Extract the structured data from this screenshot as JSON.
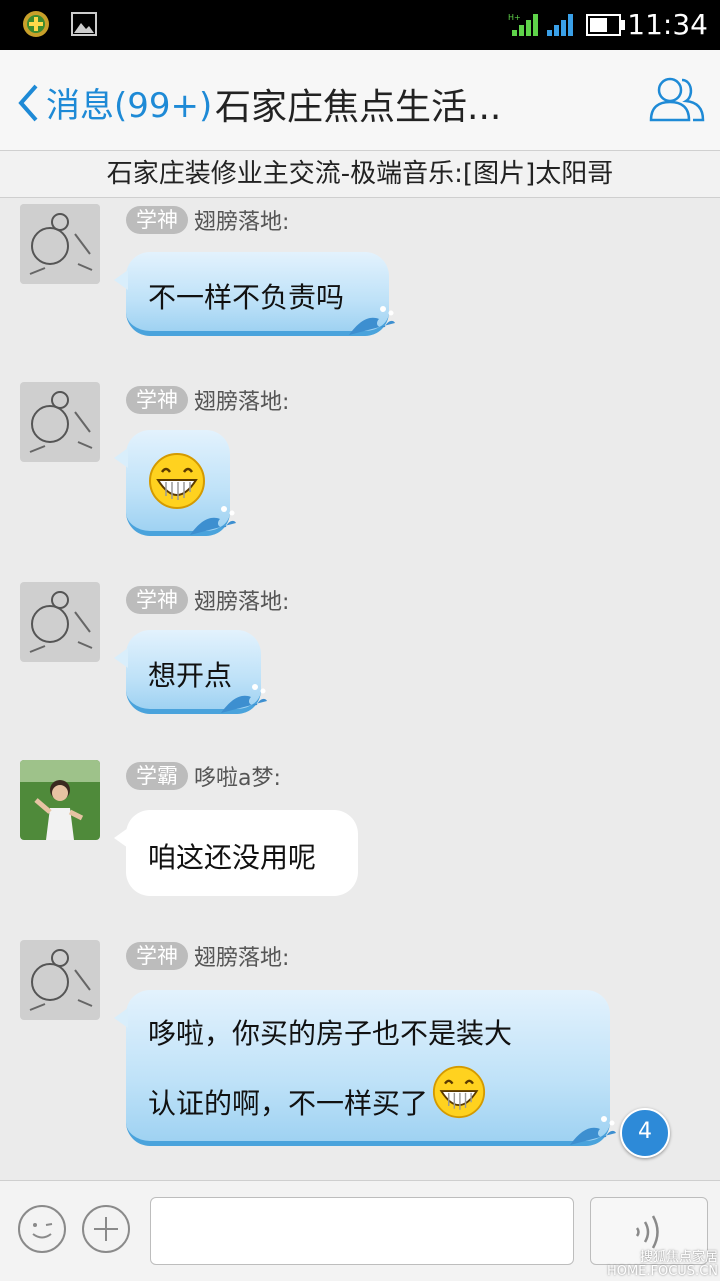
{
  "status": {
    "time": "11:34",
    "network": "H+"
  },
  "nav": {
    "back_label": "消息(99+)",
    "title": "石家庄焦点生活...",
    "contacts_icon": "group-contacts-icon"
  },
  "notice": "石家庄装修业主交流-极端音乐:[图片]太阳哥",
  "messages": [
    {
      "tag": "学神",
      "name": "翅膀落地:",
      "text": "不一样不负责吗",
      "style": "blue"
    },
    {
      "tag": "学神",
      "name": "翅膀落地:",
      "emoji": "grin-emoji",
      "style": "blue"
    },
    {
      "tag": "学神",
      "name": "翅膀落地:",
      "text": "想开点",
      "style": "blue"
    },
    {
      "tag": "学霸",
      "name": "哆啦a梦:",
      "text": "咱这还没用呢",
      "style": "white"
    },
    {
      "tag": "学神",
      "name": "翅膀落地:",
      "line1": "哆啦，你买的房子也不是装大",
      "line2": "认证的啊，不一样买了",
      "style": "blue"
    }
  ],
  "unread_badge": "4",
  "watermark": {
    "line1": "搜狐焦点家居",
    "line2": "HOME.FOCUS.CN"
  },
  "colors": {
    "accent": "#1e8ad6",
    "bubble_border": "#4aa3dc",
    "tag_bg": "#bcbcbc"
  }
}
